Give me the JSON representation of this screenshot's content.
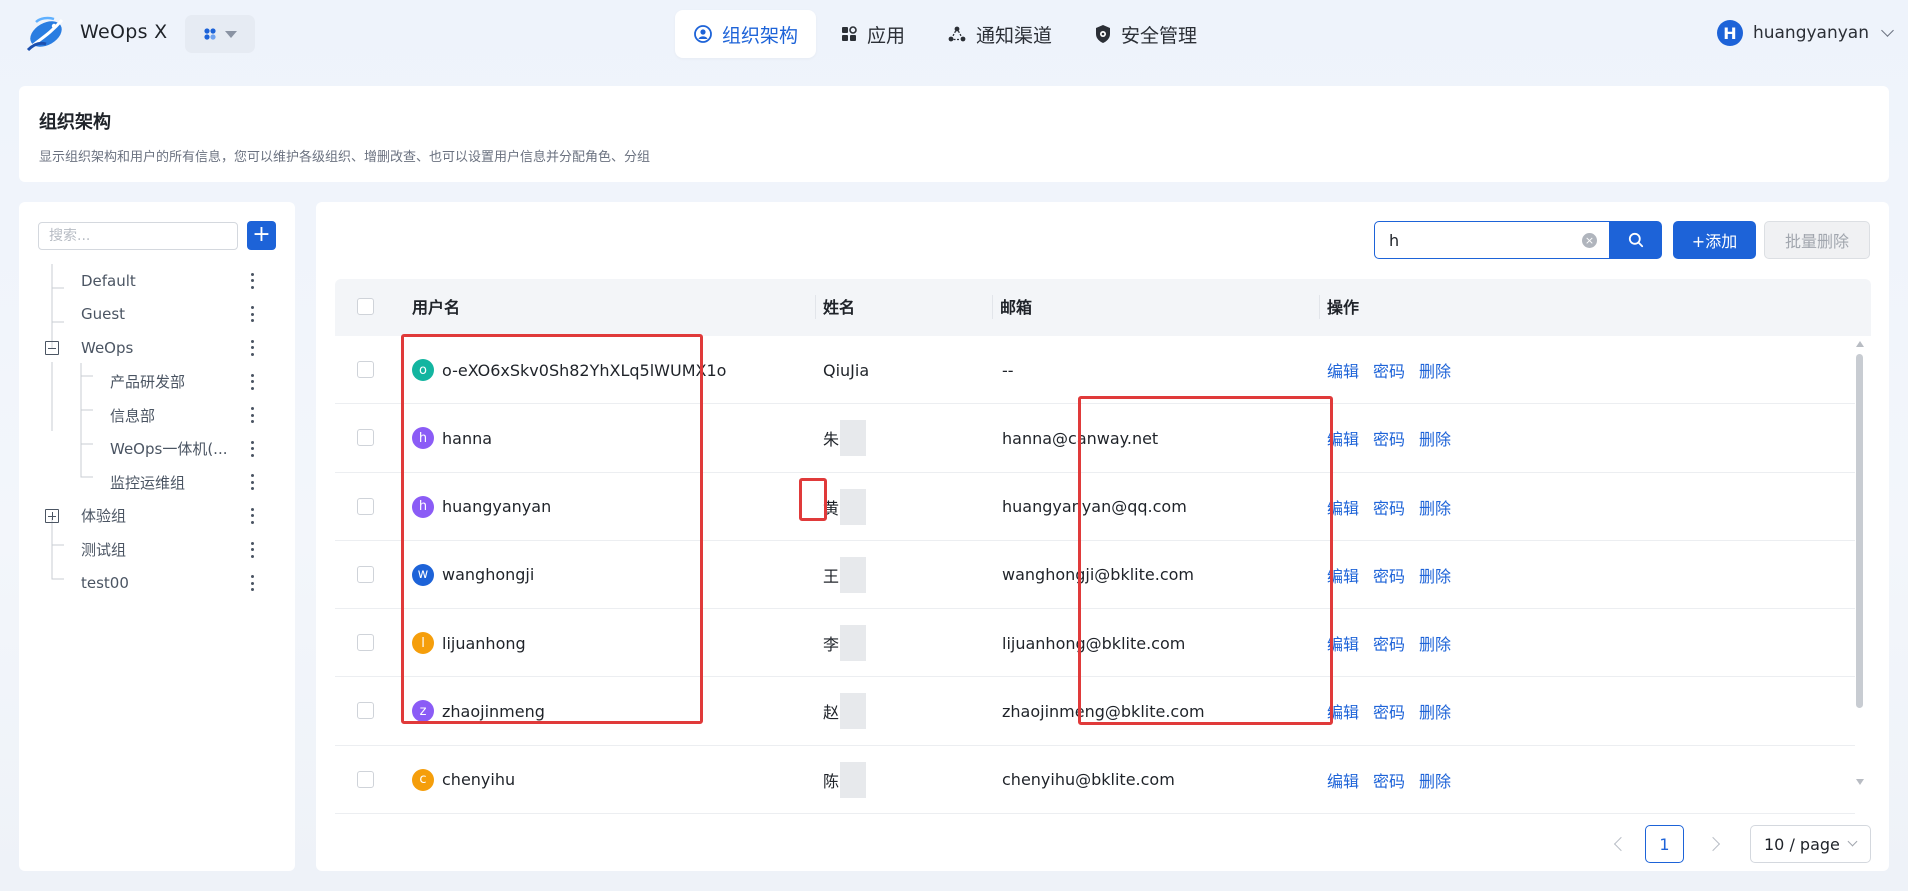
{
  "app": {
    "name": "WeOps X"
  },
  "nav": [
    {
      "label": "组织架构",
      "icon": "org-icon",
      "active": true
    },
    {
      "label": "应用",
      "icon": "apps-icon",
      "active": false
    },
    {
      "label": "通知渠道",
      "icon": "channel-icon",
      "active": false
    },
    {
      "label": "安全管理",
      "icon": "shield-icon",
      "active": false
    }
  ],
  "user": {
    "initial": "H",
    "name": "huangyanyan"
  },
  "page": {
    "title": "组织架构",
    "description": "显示组织架构和用户的所有信息，您可以维护各级组织、增删改查、也可以设置用户信息并分配角色、分组"
  },
  "tree": {
    "search_placeholder": "搜索...",
    "add_label": "+",
    "nodes": [
      {
        "label": "Default",
        "level": 0,
        "toggle": null
      },
      {
        "label": "Guest",
        "level": 0,
        "toggle": null
      },
      {
        "label": "WeOps",
        "level": 0,
        "toggle": "minus"
      },
      {
        "label": "产品研发部",
        "level": 1,
        "toggle": null
      },
      {
        "label": "信息部",
        "level": 1,
        "toggle": null
      },
      {
        "label": "WeOps一体机(...",
        "level": 1,
        "toggle": null
      },
      {
        "label": "监控运维组",
        "level": 1,
        "toggle": null
      },
      {
        "label": "体验组",
        "level": 0,
        "toggle": "plus"
      },
      {
        "label": "测试组",
        "level": 0,
        "toggle": null
      },
      {
        "label": "test00",
        "level": 0,
        "toggle": null
      }
    ]
  },
  "toolbar": {
    "search_value": "h",
    "add_label": "+添加",
    "bulk_delete_label": "批量删除"
  },
  "table": {
    "columns": [
      "用户名",
      "姓名",
      "邮箱",
      "操作"
    ],
    "actions": [
      "编辑",
      "密码",
      "删除"
    ],
    "rows": [
      {
        "initial": "o",
        "avatar_color": "#13b5a0",
        "username": "o-eXO6xSkv0Sh82YhXLq5lWUMX1o",
        "name": "QiuJia",
        "name_masked": false,
        "email": "--"
      },
      {
        "initial": "h",
        "avatar_color": "#8b5cf6",
        "username": "hanna",
        "name": "朱",
        "name_masked": true,
        "email": "hanna@canway.net"
      },
      {
        "initial": "h",
        "avatar_color": "#8b5cf6",
        "username": "huangyanyan",
        "name": "黄",
        "name_masked": true,
        "email": "huangyanyan@qq.com"
      },
      {
        "initial": "w",
        "avatar_color": "#1d63d8",
        "username": "wanghongji",
        "name": "王",
        "name_masked": true,
        "email": "wanghongji@bklite.com"
      },
      {
        "initial": "l",
        "avatar_color": "#f59e0b",
        "username": "lijuanhong",
        "name": "李",
        "name_masked": true,
        "email": "lijuanhong@bklite.com"
      },
      {
        "initial": "z",
        "avatar_color": "#8b5cf6",
        "username": "zhaojinmeng",
        "name": "赵",
        "name_masked": true,
        "email": "zhaojinmeng@bklite.com"
      },
      {
        "initial": "c",
        "avatar_color": "#f59e0b",
        "username": "chenyihu",
        "name": "陈",
        "name_masked": true,
        "email": "chenyihu@bklite.com"
      }
    ]
  },
  "pagination": {
    "current": "1",
    "page_size": "10 / page"
  },
  "colors": {
    "primary": "#1d63d8",
    "annotation": "#e03a3a"
  }
}
